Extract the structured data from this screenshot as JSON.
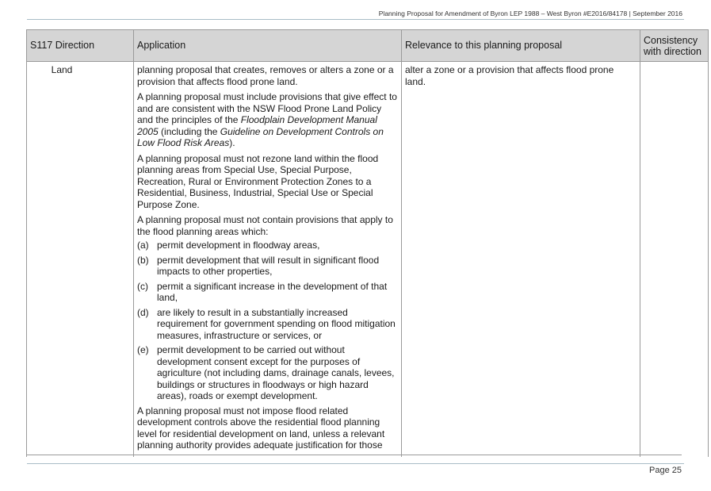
{
  "header": {
    "running_title": "Planning Proposal for Amendment of Byron LEP 1988 – West Byron #E2016/84178 | September  2016"
  },
  "table": {
    "columns": {
      "direction": "S117 Direction",
      "application": "Application",
      "relevance": "Relevance to this planning proposal",
      "consistency": "Consistency with direction"
    },
    "row": {
      "direction": "Land",
      "application": {
        "para1": "planning proposal that creates, removes or alters a zone or a provision that affects flood prone land.",
        "para2": {
          "t1": "A planning proposal must include provisions that give effect to and are consistent with the NSW Flood Prone Land Policy and the principles of the ",
          "i1": "Floodplain Development Manual 2005",
          "t2": " (including the ",
          "i2": "Guideline on Development Controls on Low Flood Risk Areas",
          "t3": ")."
        },
        "para3": "A planning proposal must not rezone land within the flood planning areas from Special Use, Special Purpose, Recreation, Rural or Environment Protection Zones to a Residential, Business, Industrial, Special Use or Special Purpose Zone.",
        "para4": "A planning proposal must not contain provisions that apply to the flood planning areas which:",
        "list": [
          {
            "marker": "(a)",
            "text": "permit development in floodway areas,"
          },
          {
            "marker": "(b)",
            "text": "permit development that will result in significant flood impacts to other properties,"
          },
          {
            "marker": "(c)",
            "text": "permit a significant increase in the development of that land,"
          },
          {
            "marker": "(d)",
            "text": "are likely to result in a substantially increased requirement for government spending on flood mitigation measures, infrastructure or services, or"
          },
          {
            "marker": "(e)",
            "text": "permit development to be carried out without development consent except for the purposes of agriculture (not including dams, drainage canals, levees, buildings or structures in floodways or high hazard areas), roads or exempt development."
          }
        ],
        "para5": "A planning proposal must not impose flood related development controls above the residential flood planning level for residential development on land, unless a relevant planning authority provides adequate justification for those"
      },
      "relevance": "alter a zone or a provision that affects flood prone land.",
      "consistency": ""
    }
  },
  "footer": {
    "page_number": "Page 25"
  }
}
